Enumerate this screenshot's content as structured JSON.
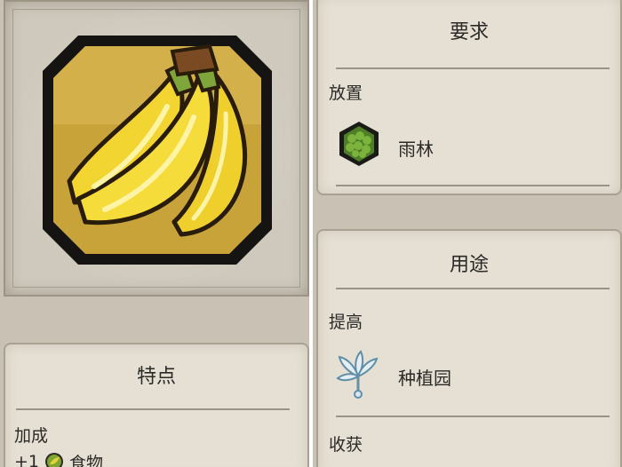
{
  "left_column": {
    "portrait": {
      "icon": "banana-icon"
    },
    "features_panel": {
      "title": "特点",
      "bonus_label": "加成",
      "bonus_amount": "+1",
      "bonus_icon": "food-icon",
      "bonus_resource": "食物"
    }
  },
  "right_column": {
    "requirements_panel": {
      "title": "要求",
      "placement_label": "放置",
      "terrain_icon": "rainforest-icon",
      "terrain_name": "雨林"
    },
    "usage_panel": {
      "title": "用途",
      "improve_label": "提高",
      "improvement_icon": "plantation-icon",
      "improvement_name": "种植园",
      "harvest_label": "收获"
    }
  },
  "colors": {
    "parchment": "#e6e0d4",
    "border": "#a9a293",
    "text": "#2b2a27",
    "frame_gold": "#c9a63a",
    "banana_yellow": "#f2d531"
  }
}
